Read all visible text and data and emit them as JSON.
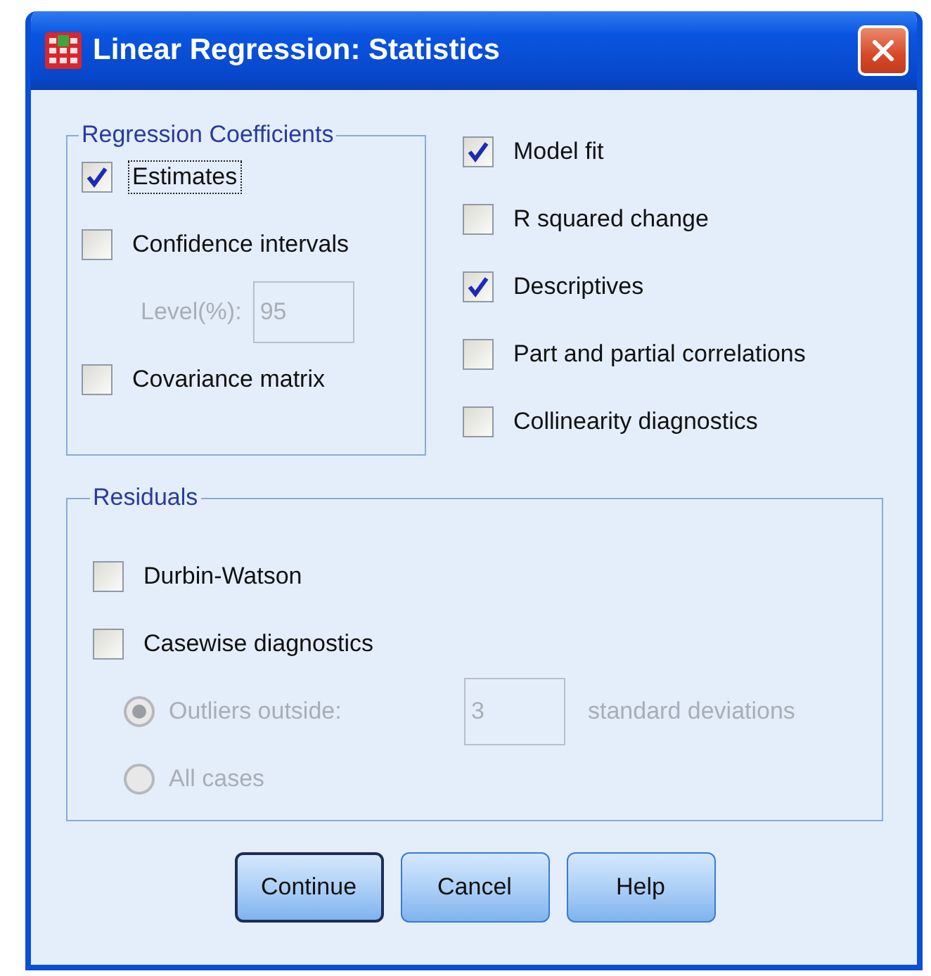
{
  "window": {
    "title": "Linear Regression: Statistics"
  },
  "coefficients": {
    "title": "Regression Coefficients",
    "items": [
      {
        "kind": "checkbox",
        "label": "Estimates",
        "checked": true,
        "focused": true
      },
      {
        "kind": "checkbox",
        "label": "Confidence intervals",
        "checked": false,
        "focused": false
      },
      {
        "kind": "field",
        "label": "Level(%):",
        "value": "95",
        "disabled": true
      },
      {
        "kind": "checkbox",
        "label": "Covariance matrix",
        "checked": false,
        "focused": false
      }
    ]
  },
  "options": [
    {
      "label": "Model fit",
      "checked": true
    },
    {
      "label": "R squared change",
      "checked": false
    },
    {
      "label": "Descriptives",
      "checked": true
    },
    {
      "label": "Part and partial correlations",
      "checked": false
    },
    {
      "label": "Collinearity diagnostics",
      "checked": false
    }
  ],
  "residuals": {
    "title": "Residuals",
    "items": [
      {
        "kind": "checkbox",
        "label": "Durbin-Watson",
        "checked": false
      },
      {
        "kind": "checkbox",
        "label": "Casewise diagnostics",
        "checked": false
      },
      {
        "kind": "radio",
        "label": "Outliers outside:",
        "selected": true,
        "disabled": true,
        "value": "3",
        "suffix": "standard deviations"
      },
      {
        "kind": "radio",
        "label": "All cases",
        "selected": false,
        "disabled": true
      }
    ]
  },
  "buttons": [
    {
      "label": "Continue",
      "default": true
    },
    {
      "label": "Cancel",
      "default": false
    },
    {
      "label": "Help",
      "default": false
    }
  ]
}
